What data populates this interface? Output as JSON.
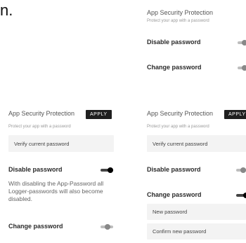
{
  "prefix_text": "n.",
  "top_panel": {
    "title": "App Security Protection",
    "subtitle": "Protect your app with a password",
    "rows": [
      {
        "label": "Disable password",
        "toggle": "off"
      },
      {
        "label": "Change password",
        "toggle": "off"
      }
    ]
  },
  "left_panel": {
    "title": "App Security Protection",
    "apply_label": "APPLY",
    "subtitle": "Protect your app with a password",
    "verify_field": "Verify current password",
    "disable_label": "Disable password",
    "disable_toggle": "on",
    "disable_desc": "With disabling the App-Password all Logger-passwords will also become disabled.",
    "change_label": "Change password",
    "change_toggle": "off"
  },
  "right_panel": {
    "title": "App Security Protection",
    "apply_label": "APPLY",
    "subtitle": "Protect your app with a password",
    "verify_field": "Verify current password",
    "disable_label": "Disable password",
    "disable_toggle": "off",
    "change_label": "Change password",
    "change_toggle": "on",
    "new_password_field": "New password",
    "confirm_password_field": "Confirm new password"
  }
}
